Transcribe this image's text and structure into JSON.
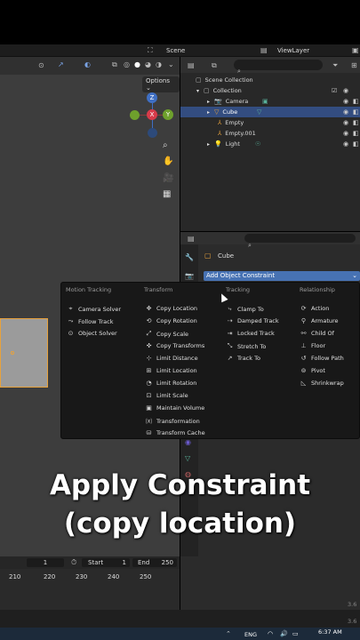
{
  "topbar": {
    "scene": "Scene",
    "view_layer": "ViewLayer"
  },
  "viewport": {
    "options_label": "Options",
    "gizmo": {
      "z": "Z",
      "y": "Y",
      "x": "X"
    }
  },
  "outliner": {
    "rows": [
      {
        "label": "Scene Collection"
      },
      {
        "label": "Collection"
      },
      {
        "label": "Camera"
      },
      {
        "label": "Cube"
      },
      {
        "label": "Empty"
      },
      {
        "label": "Empty.001"
      },
      {
        "label": "Light"
      }
    ]
  },
  "properties": {
    "object_name": "Cube",
    "add_constraint_label": "Add Object Constraint"
  },
  "menu": {
    "headers": [
      "Motion Tracking",
      "Transform",
      "Tracking",
      "Relationship"
    ],
    "motion_tracking": [
      "Camera Solver",
      "Follow Track",
      "Object Solver"
    ],
    "transform": [
      "Copy Location",
      "Copy Rotation",
      "Copy Scale",
      "Copy Transforms",
      "Limit Distance",
      "Limit Location",
      "Limit Rotation",
      "Limit Scale",
      "Maintain Volume",
      "Transformation",
      "Transform Cache"
    ],
    "tracking": [
      "Clamp To",
      "Damped Track",
      "Locked Track",
      "Stretch To",
      "Track To"
    ],
    "relationship": [
      "Action",
      "Armature",
      "Child Of",
      "Floor",
      "Follow Path",
      "Pivot",
      "Shrinkwrap"
    ]
  },
  "caption": {
    "line1": "Apply Constraint",
    "line2": "(copy location)"
  },
  "timeline": {
    "current_frame": "1",
    "start_label": "Start",
    "start_value": "1",
    "end_label": "End",
    "end_value": "250",
    "ruler": [
      "210",
      "220",
      "230",
      "240",
      "250"
    ]
  },
  "status": {
    "version_1": "3.6",
    "version_2": "3.6"
  },
  "taskbar": {
    "lang": "ENG",
    "time": "6:37 AM"
  },
  "colors": {
    "accent": "#4772b3",
    "selected_row": "#334d80",
    "active_orange": "#e8a23c"
  }
}
